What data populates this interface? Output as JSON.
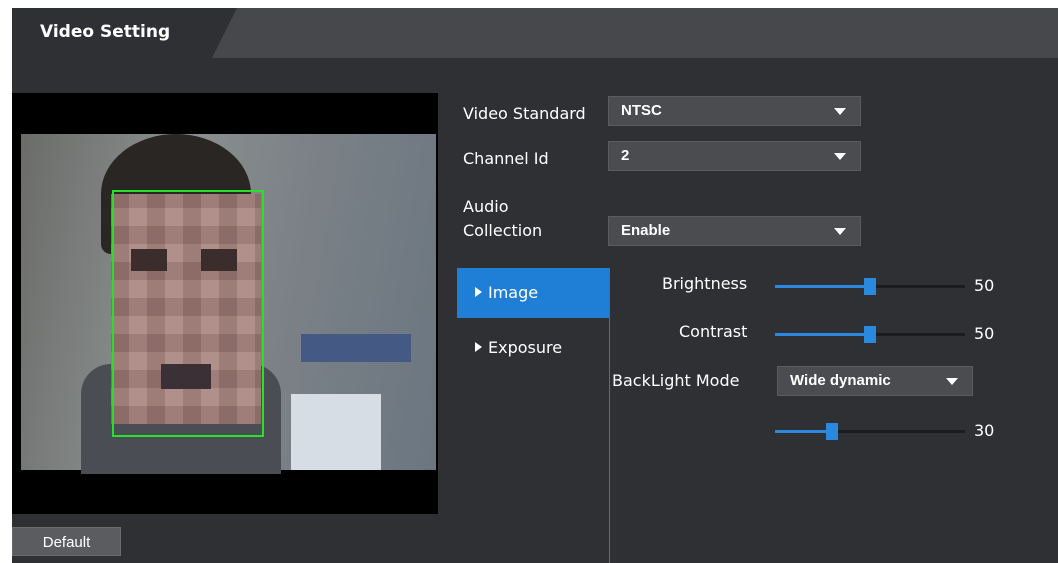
{
  "header": {
    "tab_label": "Video Setting"
  },
  "form": {
    "video_standard": {
      "label": "Video Standard",
      "value": "NTSC"
    },
    "channel_id": {
      "label": "Channel Id",
      "value": "2"
    },
    "audio_collection": {
      "label": "Audio Collection",
      "label_line1": "Audio",
      "label_line2": "Collection",
      "value": "Enable"
    }
  },
  "subtabs": [
    {
      "label": "Image",
      "active": true
    },
    {
      "label": "Exposure",
      "active": false
    }
  ],
  "image_settings": {
    "brightness": {
      "label": "Brightness",
      "value": 50,
      "max": 100
    },
    "contrast": {
      "label": "Contrast",
      "value": 50,
      "max": 100
    },
    "backlight_mode": {
      "label": "BackLight Mode",
      "value": "Wide dynamic"
    },
    "backlight_level": {
      "value": 30,
      "max": 100
    }
  },
  "buttons": {
    "default_label": "Default"
  },
  "colors": {
    "accent": "#1f7fd6",
    "face_box": "#27e02a",
    "panel_bg": "#2e3034"
  }
}
